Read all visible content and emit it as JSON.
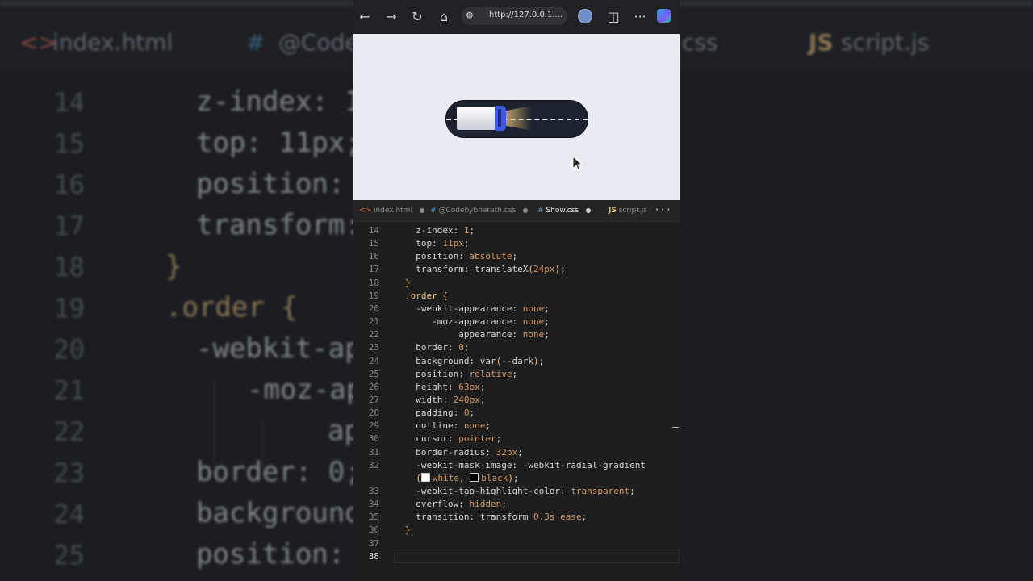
{
  "background": {
    "tabs": [
      {
        "icon": "<>",
        "label": "index.html"
      },
      {
        "icon": "#",
        "label": "@Code"
      },
      {
        "label": "css"
      },
      {
        "icon": "JS",
        "label": "script.js"
      }
    ],
    "line_numbers": [
      "14",
      "15",
      "16",
      "17",
      "18",
      "19",
      "20",
      "21",
      "22",
      "23",
      "24",
      "25"
    ],
    "lines": [
      "z-index: 1",
      "top: 11px;",
      "position:",
      "transform:",
      "}",
      ".order {",
      "-webkit-ap",
      "-moz-ap",
      "ap",
      "border: 0;",
      "background",
      "position:"
    ]
  },
  "browser": {
    "url": "http://127.0.0.1...."
  },
  "editor": {
    "tabs": [
      {
        "icon": "<>",
        "label": "index.html",
        "modified": true
      },
      {
        "icon": "#",
        "label": "@Codebybharath.css",
        "modified": true
      },
      {
        "icon": "#",
        "label": "Show.css",
        "modified": true,
        "active": true
      },
      {
        "icon": "JS",
        "label": "script.js",
        "modified": false
      }
    ],
    "more": "···",
    "lines": [
      {
        "n": "14",
        "t": "  z-index: 1;"
      },
      {
        "n": "15",
        "t": "  top: 11px;"
      },
      {
        "n": "16",
        "t": "  position: absolute;"
      },
      {
        "n": "17",
        "t": "  transform: translateX(24px);"
      },
      {
        "n": "18",
        "t": "}"
      },
      {
        "n": "19",
        "t": ".order {"
      },
      {
        "n": "20",
        "t": "  -webkit-appearance: none;"
      },
      {
        "n": "21",
        "t": "     -moz-appearance: none;"
      },
      {
        "n": "22",
        "t": "          appearance: none;"
      },
      {
        "n": "23",
        "t": "  border: 0;"
      },
      {
        "n": "24",
        "t": "  background: var(--dark);"
      },
      {
        "n": "25",
        "t": "  position: relative;"
      },
      {
        "n": "26",
        "t": "  height: 63px;"
      },
      {
        "n": "27",
        "t": "  width: 240px;"
      },
      {
        "n": "28",
        "t": "  padding: 0;"
      },
      {
        "n": "29",
        "t": "  outline: none;"
      },
      {
        "n": "30",
        "t": "  cursor: pointer;"
      },
      {
        "n": "31",
        "t": "  border-radius: 32px;"
      },
      {
        "n": "32",
        "t": "  -webkit-mask-image: -webkit-radial-gradient"
      },
      {
        "n": "",
        "t": "  (white, black);"
      },
      {
        "n": "33",
        "t": "  -webkit-tap-highlight-color: transparent;"
      },
      {
        "n": "34",
        "t": "  overflow: hidden;"
      },
      {
        "n": "35",
        "t": "  transition: transform 0.3s ease;"
      },
      {
        "n": "36",
        "t": "}"
      },
      {
        "n": "37",
        "t": ""
      },
      {
        "n": "38",
        "t": ""
      }
    ]
  }
}
